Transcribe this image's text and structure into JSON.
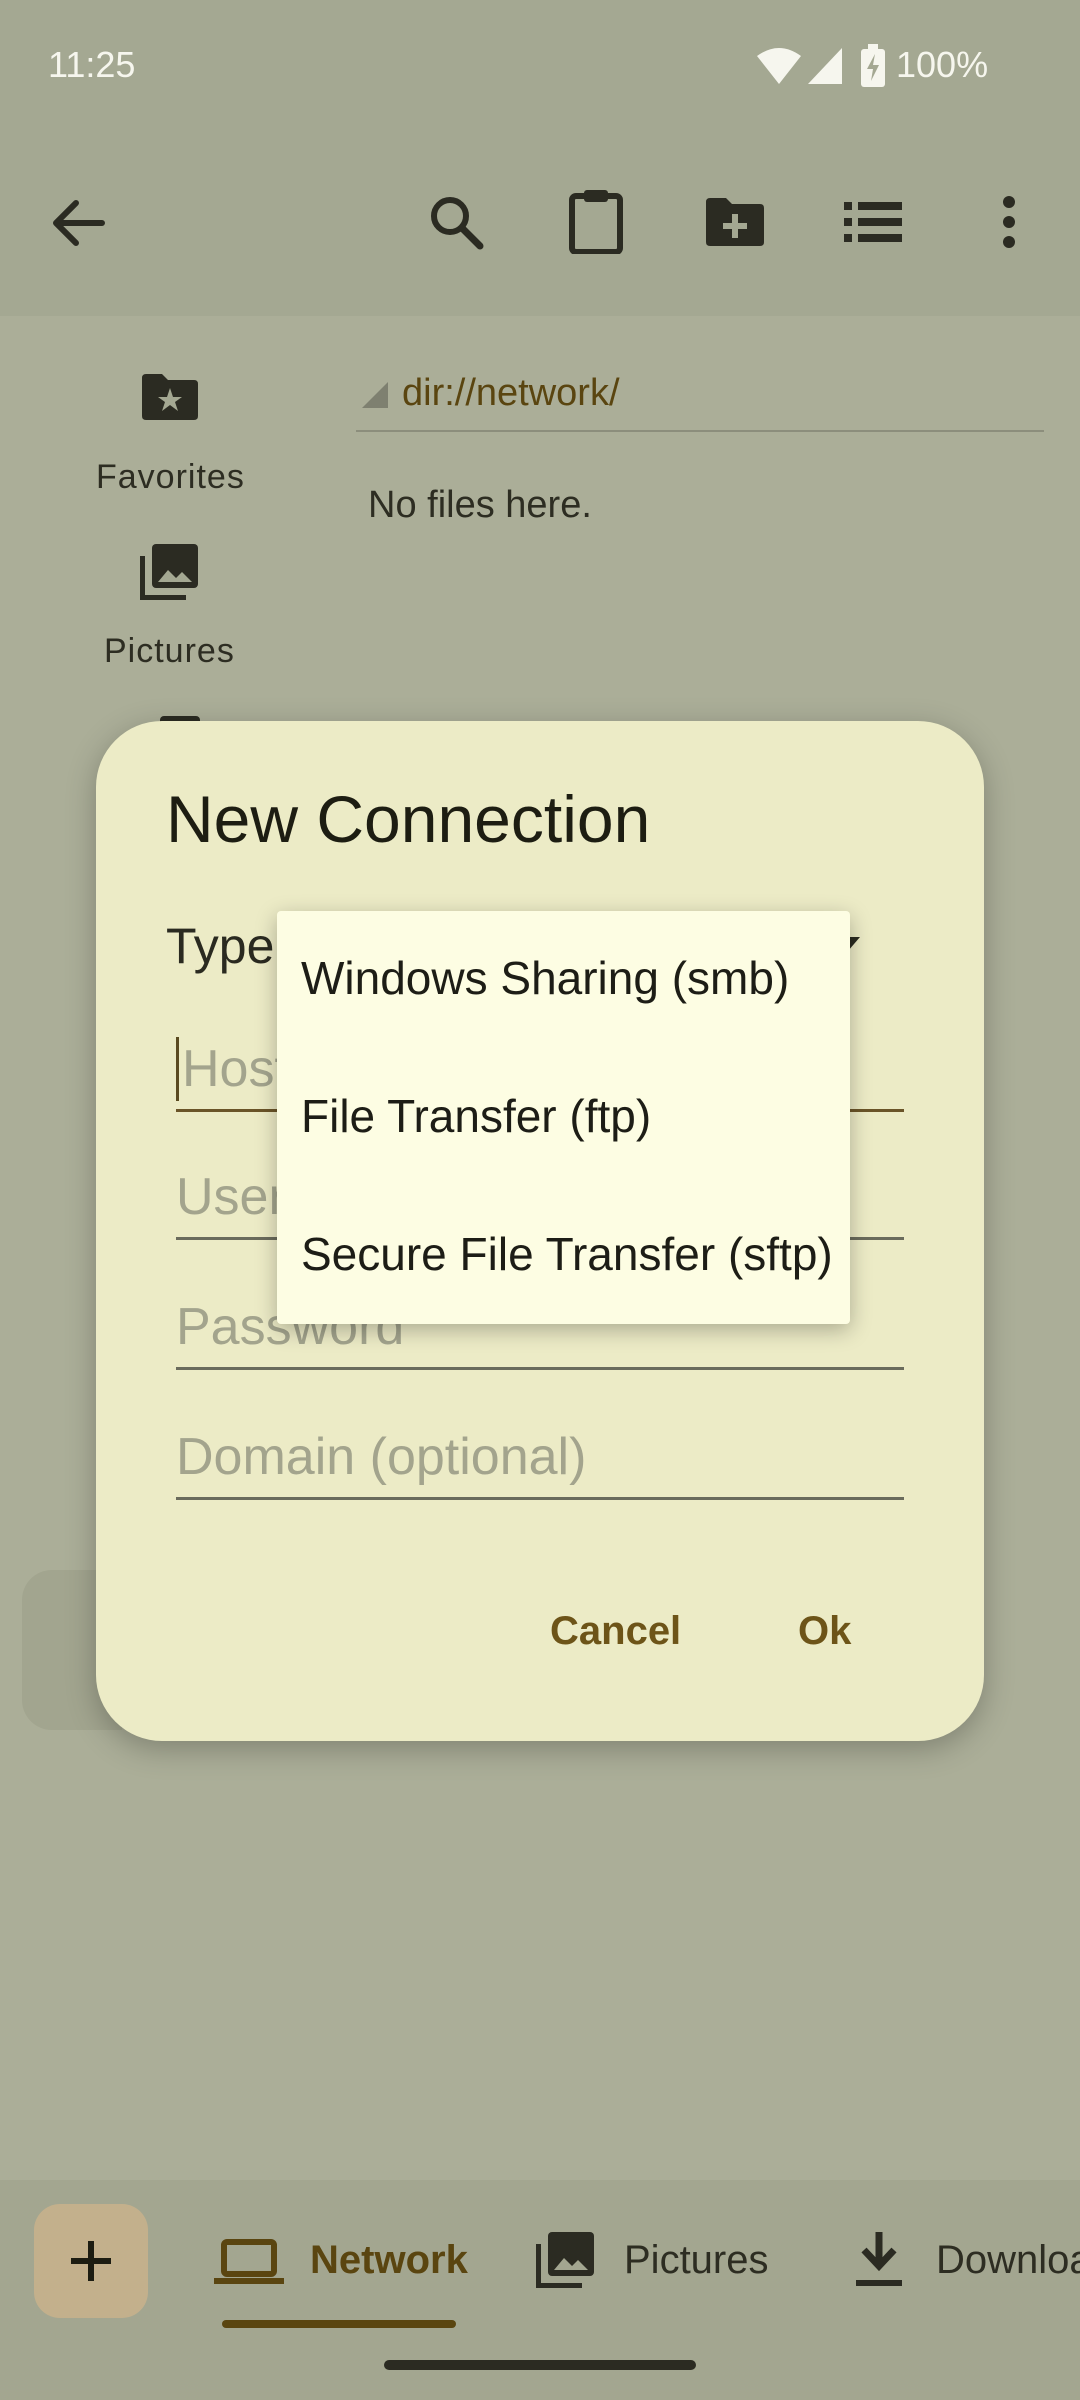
{
  "status_bar": {
    "time": "11:25",
    "battery": "100%"
  },
  "app_bar": {
    "icons": [
      "back-arrow-icon",
      "search-icon",
      "clipboard-icon",
      "new-folder-icon",
      "list-view-icon",
      "more-vert-icon"
    ]
  },
  "sidebar": {
    "items": [
      {
        "label": "Favorites",
        "icon": "favorites-folder-icon"
      },
      {
        "label": "Pictures",
        "icon": "pictures-icon"
      }
    ]
  },
  "path": {
    "text": "dir://network/"
  },
  "empty_message": "No files here.",
  "dialog": {
    "title": "New Connection",
    "type_label": "Type",
    "fields": {
      "host_placeholder": "Host",
      "username_placeholder": "User",
      "password_placeholder": "Password",
      "domain_placeholder": "Domain (optional)"
    },
    "cancel_label": "Cancel",
    "ok_label": "Ok"
  },
  "dropdown": {
    "options": [
      "Windows Sharing (smb)",
      "File Transfer (ftp)",
      "Secure File Transfer (sftp)"
    ]
  },
  "bottom_nav": {
    "fab_icon": "add-icon",
    "tabs": [
      {
        "label": "Network",
        "icon": "laptop-icon"
      },
      {
        "label": "Pictures",
        "icon": "pictures-icon"
      },
      {
        "label": "Downloa",
        "icon": "download-icon"
      }
    ]
  }
}
